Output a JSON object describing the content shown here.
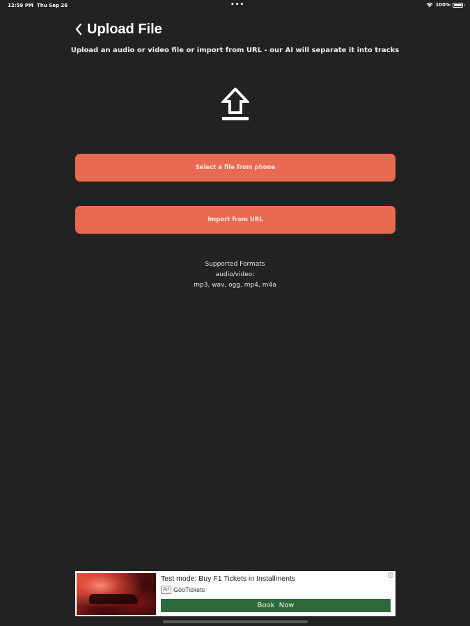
{
  "status_bar": {
    "time": "12:59 PM",
    "date": "Thu Sep 26",
    "dots": "•••",
    "battery": "100%"
  },
  "header": {
    "title": "Upload File",
    "back_icon": "chevron-left-icon"
  },
  "subtitle": "Upload an audio or video file or import from URL - our AI will separate it into tracks",
  "upload_icon": "upload-arrow-icon",
  "buttons": {
    "select_file": "Select a file from phone",
    "import_url": "Import from URL",
    "accent_color": "#e96a51"
  },
  "formats": {
    "heading": "Supported Formats",
    "category": "audio/video:",
    "list": "mp3, wav, ogg, mp4, m4a"
  },
  "ad": {
    "title": "Test mode: Buy F1 Tickets in Installments",
    "badge": "Ad",
    "advertiser": "GooTickets",
    "cta": "Book  Now",
    "cta_color": "#2e6b3a"
  },
  "colors": {
    "background": "#222222"
  }
}
